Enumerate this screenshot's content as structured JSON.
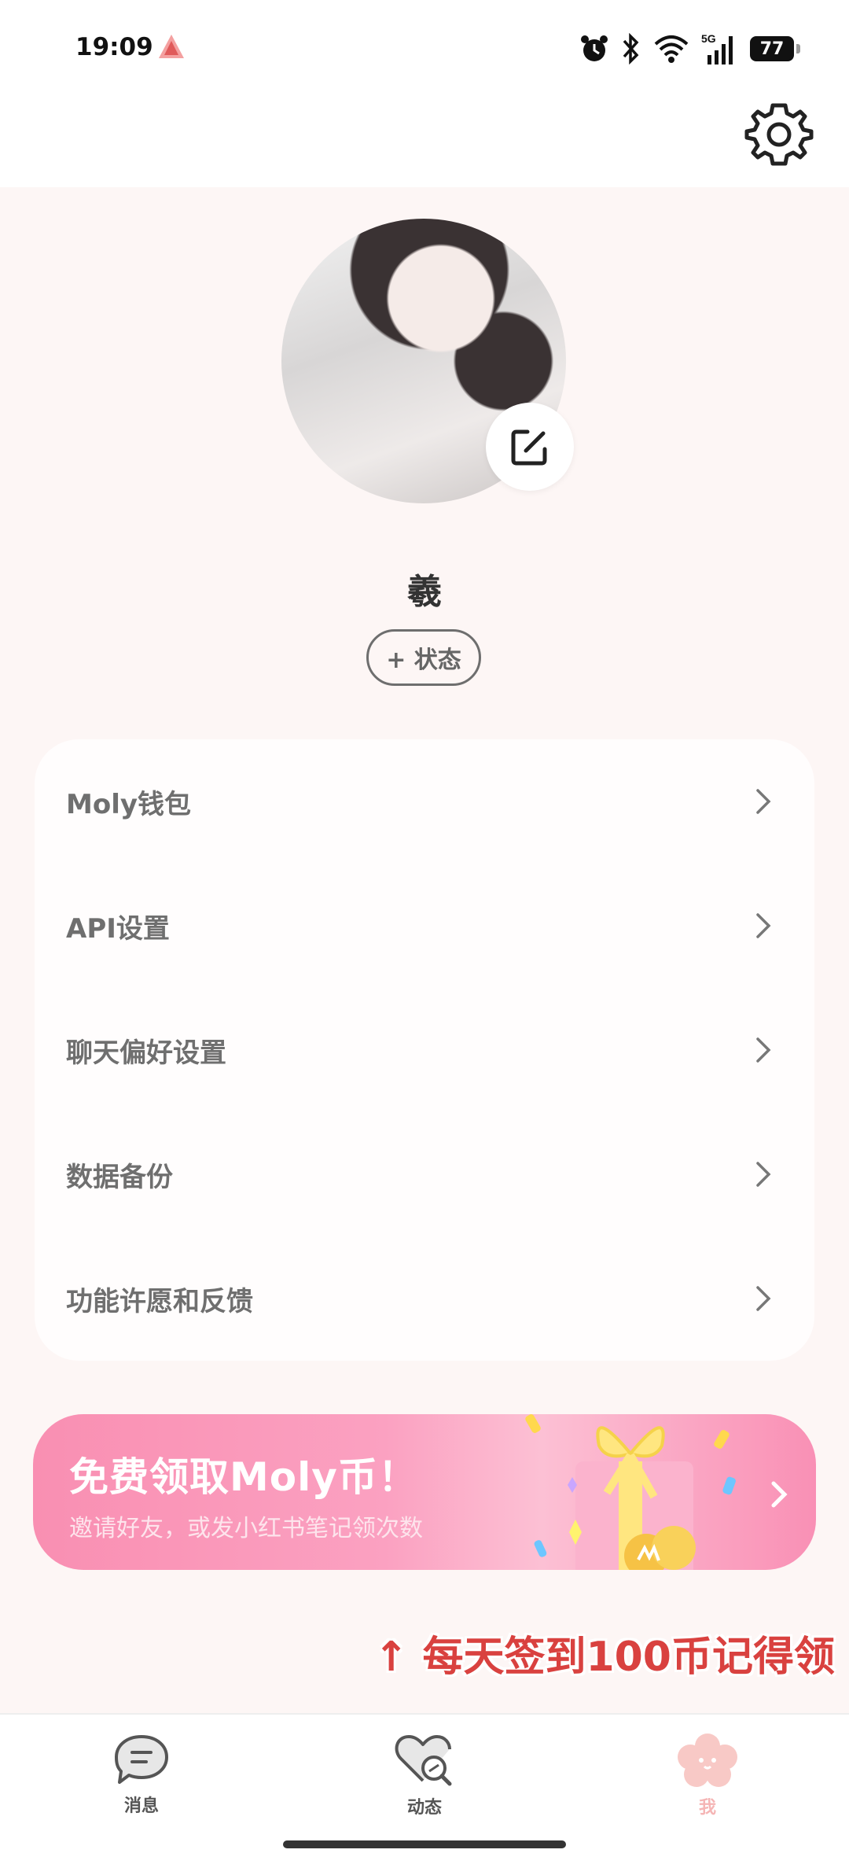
{
  "status_bar": {
    "time": "19:09",
    "battery": "77",
    "network": "5G"
  },
  "profile": {
    "username": "羲",
    "status_button": "+ 状态"
  },
  "menu": [
    {
      "label": "Moly钱包"
    },
    {
      "label": "API设置"
    },
    {
      "label": "聊天偏好设置"
    },
    {
      "label": "数据备份"
    },
    {
      "label": "功能许愿和反馈"
    }
  ],
  "promo": {
    "title": "免费领取Moly币！",
    "subtitle": "邀请好友，或发小红书笔记领次数"
  },
  "hint": "↑ 每天签到100币记得领",
  "tabs": [
    {
      "label": "消息",
      "active": false
    },
    {
      "label": "动态",
      "active": false
    },
    {
      "label": "我",
      "active": true
    }
  ],
  "colors": {
    "accent": "#f98fb2",
    "active_tab": "#f5b5b5",
    "hint_red": "#d9413f"
  }
}
